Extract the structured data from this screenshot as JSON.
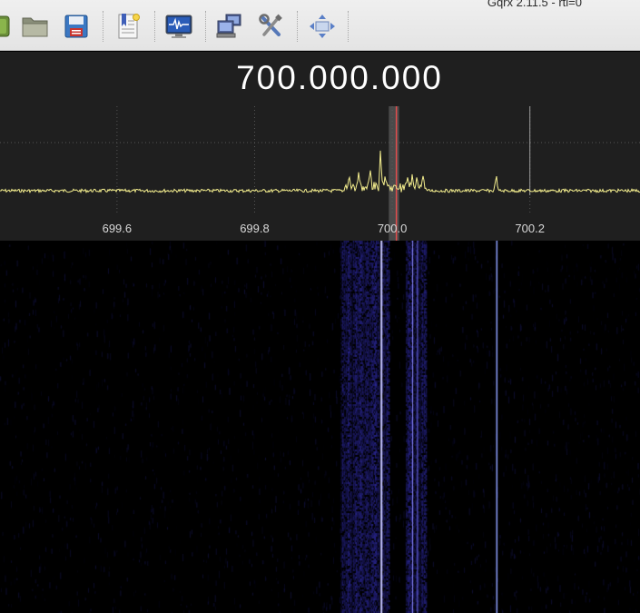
{
  "window": {
    "title": "Gqrx 2.11.5 - rtl=0"
  },
  "toolbar": {
    "buttons": [
      {
        "name": "start-dsp-button",
        "icon": "power-icon"
      },
      {
        "name": "open-file-button",
        "icon": "folder-open-icon"
      },
      {
        "name": "save-settings-button",
        "icon": "floppy-disk-icon"
      },
      {
        "name": "bookmarks-button",
        "icon": "bookmark-document-icon"
      },
      {
        "name": "io-devices-button",
        "icon": "monitor-waveform-icon"
      },
      {
        "name": "remote-control-button",
        "icon": "network-computers-icon"
      },
      {
        "name": "configure-button",
        "icon": "tools-icon"
      },
      {
        "name": "fft-fullscreen-button",
        "icon": "expand-arrows-icon"
      }
    ]
  },
  "receiver": {
    "frequency": "700.000.000"
  },
  "chart_data": {
    "type": "line",
    "xlabel": "",
    "ylabel": "",
    "x_ticks": [
      "699.6",
      "699.8",
      "700.0",
      "700.2"
    ],
    "x_tick_values": [
      699.6,
      699.8,
      700.0,
      700.2
    ],
    "xlim": [
      699.43,
      700.36
    ],
    "grid": true,
    "demod_center_mhz": 700.006,
    "filter_band_mhz": [
      699.995,
      700.01
    ],
    "marker_line_mhz": 700.2,
    "peaks": [
      {
        "x": 699.937,
        "rel": 0.18
      },
      {
        "x": 699.951,
        "rel": 0.25
      },
      {
        "x": 699.968,
        "rel": 0.3
      },
      {
        "x": 699.983,
        "rel": 0.7
      },
      {
        "x": 699.99,
        "rel": 0.22
      },
      {
        "x": 700.022,
        "rel": 0.18
      },
      {
        "x": 700.029,
        "rel": 0.25
      },
      {
        "x": 700.036,
        "rel": 0.2
      },
      {
        "x": 700.045,
        "rel": 0.18
      },
      {
        "x": 700.151,
        "rel": 0.3
      }
    ]
  },
  "colors": {
    "trace": "#f4ee8e",
    "demod_line": "#e24d4d",
    "filter_band": "#5a5a5a",
    "plot_bg": "#1f1f1f",
    "waterfall_signal": "#3b35c9"
  }
}
